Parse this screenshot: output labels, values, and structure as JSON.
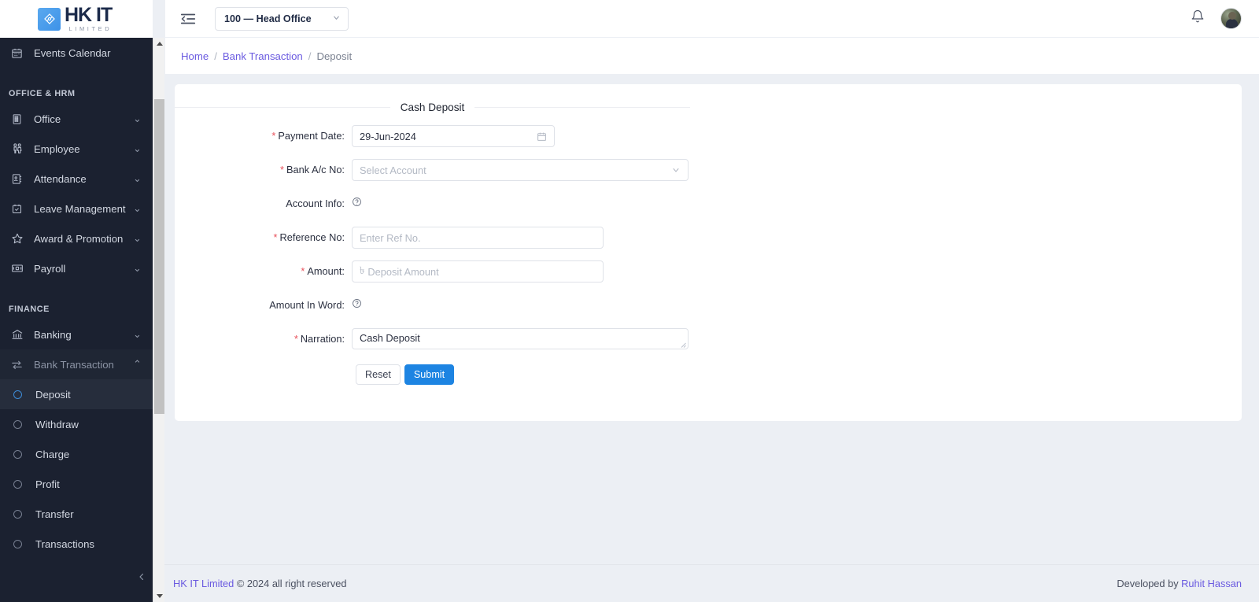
{
  "brand": {
    "logo_primary": "HK IT",
    "logo_sub": "LIMITED",
    "accent_color": "#1d84e2",
    "sidebar_color": "#1b2130",
    "link_color": "#6a5ae0"
  },
  "header": {
    "menu_fold_icon": "menu-fold-icon",
    "branch_value": "100 — Head Office",
    "branch_caret": "⌄",
    "bell_icon": "bell-icon",
    "avatar_icon": "user-avatar"
  },
  "breadcrumb": {
    "items": [
      {
        "label": "Home",
        "link": true
      },
      {
        "label": "Bank Transaction",
        "link": true
      },
      {
        "label": "Deposit",
        "link": false
      }
    ],
    "separator": "/"
  },
  "sidebar": {
    "top_items": [
      {
        "label": "Events Calendar",
        "icon": "calendar-icon"
      }
    ],
    "groups": [
      {
        "title": "OFFICE & HRM",
        "items": [
          {
            "label": "Office",
            "icon": "building-icon",
            "expandable": true,
            "expanded": false
          },
          {
            "label": "Employee",
            "icon": "employees-icon",
            "expandable": true,
            "expanded": false
          },
          {
            "label": "Attendance",
            "icon": "attendance-icon",
            "expandable": true,
            "expanded": false
          },
          {
            "label": "Leave Management",
            "icon": "calendar-check-icon",
            "expandable": true,
            "expanded": false
          },
          {
            "label": "Award & Promotion",
            "icon": "star-icon",
            "expandable": true,
            "expanded": false
          },
          {
            "label": "Payroll",
            "icon": "payroll-icon",
            "expandable": true,
            "expanded": false
          }
        ]
      },
      {
        "title": "FINANCE",
        "items": [
          {
            "label": "Banking",
            "icon": "bank-icon",
            "expandable": true,
            "expanded": false
          },
          {
            "label": "Bank Transaction",
            "icon": "transfer-arrows-icon",
            "expandable": true,
            "expanded": true
          }
        ]
      }
    ],
    "sub_items": [
      {
        "label": "Deposit",
        "active": true
      },
      {
        "label": "Withdraw",
        "active": false
      },
      {
        "label": "Charge",
        "active": false
      },
      {
        "label": "Profit",
        "active": false
      },
      {
        "label": "Transfer",
        "active": false
      },
      {
        "label": "Transactions",
        "active": false
      }
    ],
    "collapse_icon": "chevron-left-icon",
    "chevron_down": "⌄",
    "chevron_up": "⌃"
  },
  "form": {
    "title": "Cash Deposit",
    "fields": {
      "payment_date": {
        "label": "Payment Date:",
        "required": true,
        "value": "29-Jun-2024",
        "icon": "calendar-icon"
      },
      "bank_account": {
        "label": "Bank A/c No:",
        "required": true,
        "value": "",
        "placeholder": "Select Account",
        "icon": "chevron-down-icon"
      },
      "account_info": {
        "label": "Account Info:",
        "required": false,
        "value": "",
        "icon": "question-circle-icon"
      },
      "reference_no": {
        "label": "Reference No:",
        "required": true,
        "value": "",
        "placeholder": "Enter Ref No."
      },
      "amount": {
        "label": "Amount:",
        "required": true,
        "value": "",
        "placeholder": "Deposit Amount",
        "currency_symbol": "৳"
      },
      "amount_in_word": {
        "label": "Amount In Word:",
        "required": false,
        "value": "",
        "icon": "question-circle-icon"
      },
      "narration": {
        "label": "Narration:",
        "required": true,
        "value": "Cash Deposit"
      }
    },
    "buttons": {
      "reset": "Reset",
      "submit": "Submit"
    },
    "required_marker": "*"
  },
  "footer": {
    "company": "HK IT Limited",
    "copyright": "© 2024 all right reserved",
    "developed_prefix": "Developed by ",
    "developer": "Ruhit Hassan"
  }
}
